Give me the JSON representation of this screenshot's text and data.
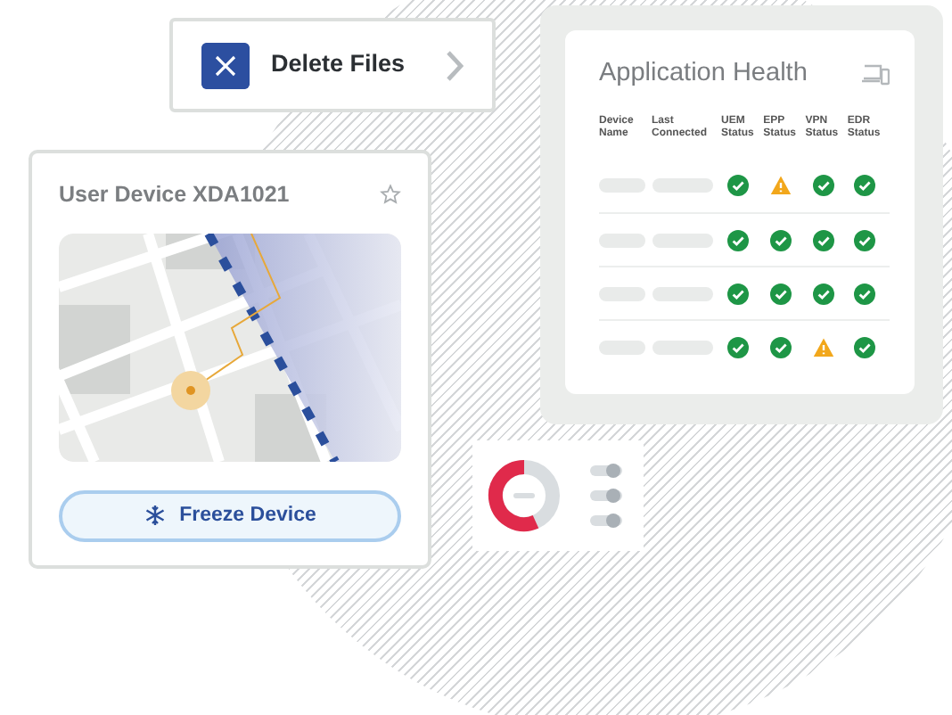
{
  "delete_action": {
    "label": "Delete Files"
  },
  "device_card": {
    "title": "User Device XDA1021",
    "button": "Freeze Device"
  },
  "health_card": {
    "title": "Application Health",
    "columns": [
      "Device Name",
      "Last Connected",
      "UEM Status",
      "EPP Status",
      "VPN Status",
      "EDR Status"
    ],
    "rows": [
      {
        "statuses": [
          {
            "warning": false
          },
          {
            "warning": true
          },
          {
            "warning": false
          },
          {
            "warning": false
          }
        ]
      },
      {
        "statuses": [
          {
            "warning": false
          },
          {
            "warning": false
          },
          {
            "warning": false
          },
          {
            "warning": false
          }
        ]
      },
      {
        "statuses": [
          {
            "warning": false
          },
          {
            "warning": false
          },
          {
            "warning": false
          },
          {
            "warning": false
          }
        ]
      },
      {
        "statuses": [
          {
            "warning": false
          },
          {
            "warning": false
          },
          {
            "warning": true
          },
          {
            "warning": false
          }
        ]
      }
    ]
  }
}
